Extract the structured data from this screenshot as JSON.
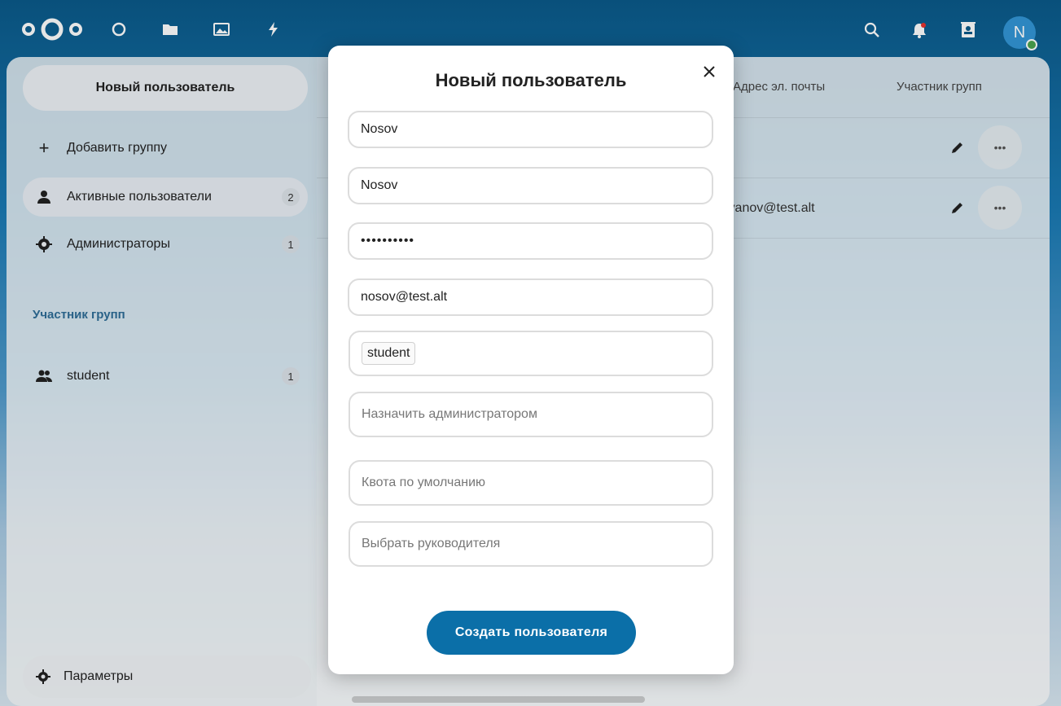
{
  "header": {
    "apps": [
      "dashboard-icon",
      "files-icon",
      "photos-icon",
      "activity-icon"
    ],
    "right_icons": [
      "search-icon",
      "notifications-icon",
      "contacts-icon"
    ],
    "avatar_letter": "N"
  },
  "sidebar": {
    "new_user_label": "Новый пользователь",
    "add_group_label": "Добавить группу",
    "items": [
      {
        "label": "Активные пользователи",
        "count": "2"
      },
      {
        "label": "Администраторы",
        "count": "1"
      }
    ],
    "groups_caption": "Участник групп",
    "groups": [
      {
        "label": "student",
        "count": "1"
      }
    ],
    "settings_label": "Параметры"
  },
  "table": {
    "col_email": "Адрес эл. почты",
    "col_groups": "Участник групп",
    "rows": [
      {
        "email": ""
      },
      {
        "email": "ivanov@test.alt"
      }
    ]
  },
  "modal": {
    "title": "Новый пользователь",
    "username_value": "Nosov",
    "display_name_value": "Nosov",
    "password_value": "••••••••••",
    "email_value": "nosov@test.alt",
    "group_tag": "student",
    "admin_placeholder": "Назначить администратором",
    "quota_placeholder": "Квота по умолчанию",
    "manager_placeholder": "Выбрать руководителя",
    "create_label": "Создать пользователя"
  },
  "colors": {
    "primary": "#0b6fa8",
    "header_bg": "#0b5a8a",
    "online": "#4ba44e"
  }
}
